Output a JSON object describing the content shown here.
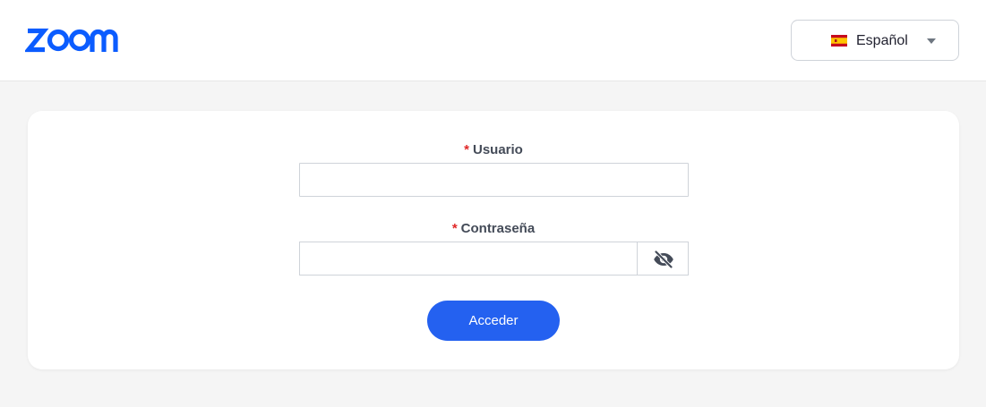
{
  "header": {
    "logo_text": "ZOOM",
    "language": {
      "selected": "Español",
      "flag_icon": "spain-flag-icon",
      "caret_icon": "caret-down-icon"
    }
  },
  "form": {
    "username": {
      "required_marker": "*",
      "label": "Usuario",
      "value": "",
      "placeholder": ""
    },
    "password": {
      "required_marker": "*",
      "label": "Contraseña",
      "value": "",
      "placeholder": "",
      "toggle_icon": "eye-off-icon"
    },
    "submit_label": "Acceder"
  },
  "colors": {
    "brand": "#0b5cff",
    "button": "#2461f0",
    "required": "#e02828",
    "page_bg": "#f5f5f5"
  }
}
